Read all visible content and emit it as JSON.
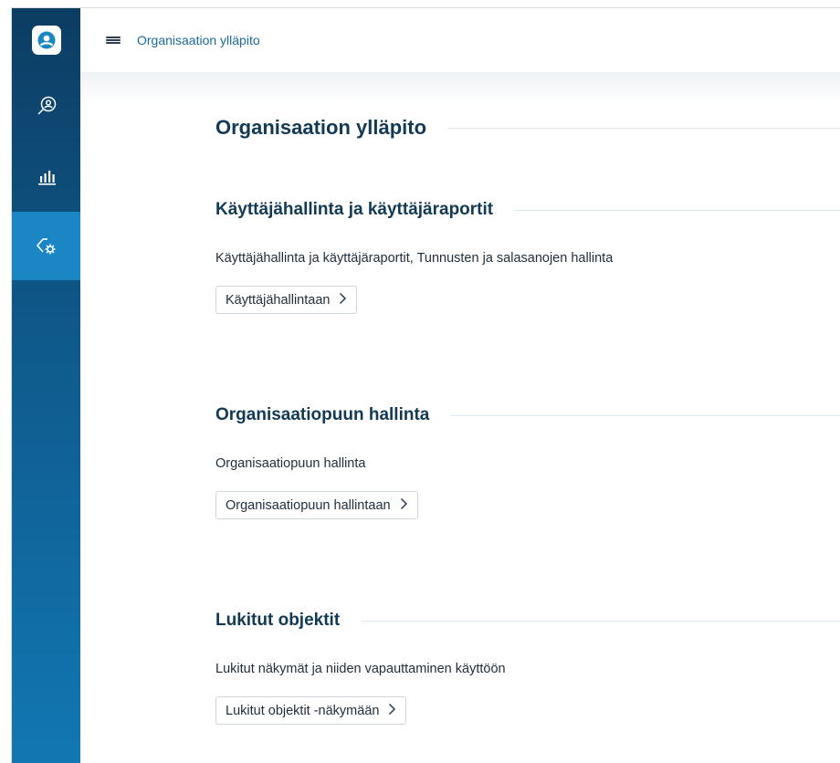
{
  "breadcrumb": "Organisaation ylläpito",
  "page_title": "Organisaation ylläpito",
  "sidebar": {
    "items": [
      {
        "icon": "search-user-icon",
        "active": false
      },
      {
        "icon": "bar-chart-icon",
        "active": false
      },
      {
        "icon": "settings-tag-icon",
        "active": true
      }
    ]
  },
  "sections": [
    {
      "title": "Käyttäjähallinta ja käyttäjäraportit",
      "description": "Käyttäjähallinta ja käyttäjäraportit, Tunnusten ja salasanojen hallinta",
      "button_label": "Käyttäjähallintaan"
    },
    {
      "title": "Organisaatiopuun hallinta",
      "description": "Organisaatiopuun hallinta",
      "button_label": "Organisaatiopuun hallintaan"
    },
    {
      "title": "Lukitut objektit",
      "description": "Lukitut näkymät ja niiden vapauttaminen käyttöön",
      "button_label": "Lukitut objektit -näkymään"
    }
  ],
  "colors": {
    "sidebar_top": "#0c3d63",
    "sidebar_bottom": "#1277b2",
    "sidebar_active": "#1a86c4",
    "heading": "#123a55",
    "link": "#1a6a9a"
  }
}
